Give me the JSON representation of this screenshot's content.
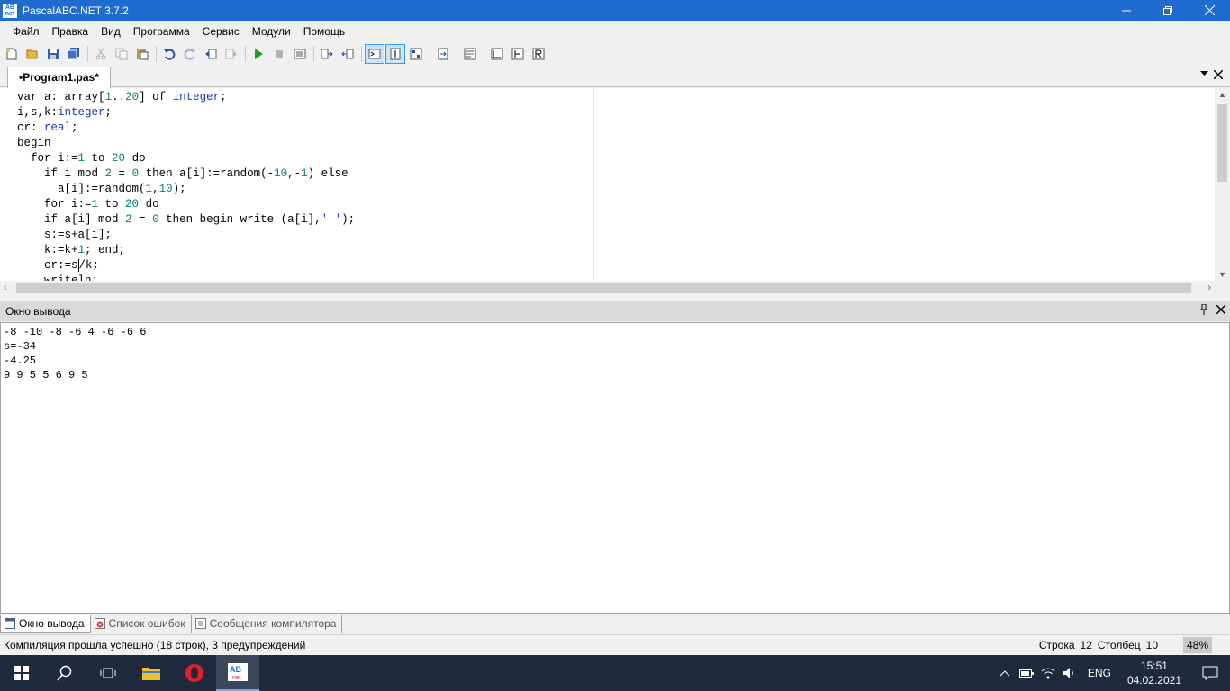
{
  "window": {
    "title": "PascalABC.NET 3.7.2",
    "app_icon_text": "AB\nnet"
  },
  "menu": [
    "Файл",
    "Правка",
    "Вид",
    "Программа",
    "Сервис",
    "Модули",
    "Помощь"
  ],
  "document_tab": {
    "label": "•Program1.pas*"
  },
  "editor": {
    "lines": [
      [
        [
          "kw",
          "var a: "
        ],
        [
          "kw",
          "array"
        ],
        [
          "kw",
          "["
        ],
        [
          "nm",
          "1"
        ],
        [
          "kw",
          ".."
        ],
        [
          "nm",
          "20"
        ],
        [
          "kw",
          "] "
        ],
        [
          "kw",
          "of "
        ],
        [
          "ty",
          "integer"
        ],
        [
          "kw",
          ";"
        ]
      ],
      [
        [
          "kw",
          "i,s,k:"
        ],
        [
          "ty",
          "integer"
        ],
        [
          "kw",
          ";"
        ]
      ],
      [
        [
          "kw",
          "cr: "
        ],
        [
          "ty",
          "real"
        ],
        [
          "kw",
          ";"
        ]
      ],
      [
        [
          "kw",
          "begin"
        ]
      ],
      [
        [
          "kw",
          "  for i:="
        ],
        [
          "nm",
          "1"
        ],
        [
          "kw",
          " to "
        ],
        [
          "nm",
          "20"
        ],
        [
          "kw",
          " do"
        ]
      ],
      [
        [
          "kw",
          "    if i mod "
        ],
        [
          "nm",
          "2"
        ],
        [
          "kw",
          " = "
        ],
        [
          "nm",
          "0"
        ],
        [
          "kw",
          " then a[i]:=random(-"
        ],
        [
          "nm",
          "10"
        ],
        [
          "kw",
          ",-"
        ],
        [
          "nm",
          "1"
        ],
        [
          "kw",
          ") else"
        ]
      ],
      [
        [
          "kw",
          "      a[i]:=random("
        ],
        [
          "nm",
          "1"
        ],
        [
          "kw",
          ","
        ],
        [
          "nm",
          "10"
        ],
        [
          "kw",
          ");"
        ]
      ],
      [
        [
          "kw",
          "    for i:="
        ],
        [
          "nm",
          "1"
        ],
        [
          "kw",
          " to "
        ],
        [
          "nm",
          "20"
        ],
        [
          "kw",
          " do"
        ]
      ],
      [
        [
          "kw",
          "    if a[i] mod "
        ],
        [
          "nm",
          "2"
        ],
        [
          "kw",
          " = "
        ],
        [
          "nm",
          "0"
        ],
        [
          "kw",
          " then begin write (a[i],"
        ],
        [
          "st",
          "' '"
        ],
        [
          "kw",
          ");"
        ]
      ],
      [
        [
          "kw",
          "    s:=s+a[i];"
        ]
      ],
      [
        [
          "kw",
          "    k:=k+"
        ],
        [
          "nm",
          "1"
        ],
        [
          "kw",
          "; end;"
        ]
      ],
      [
        [
          "kw",
          "    cr:=s"
        ],
        [
          "caret",
          ""
        ],
        [
          "kw",
          "/k;"
        ]
      ],
      [
        [
          "kw",
          "    writeln;"
        ]
      ]
    ]
  },
  "output": {
    "header": "Окно вывода",
    "lines": [
      "-8 -10 -8 -6 4 -6 -6 6",
      "s=-34",
      "-4.25",
      "9 9 5 5 6 9 5"
    ]
  },
  "bottom_tabs": [
    "Окно вывода",
    "Список ошибок",
    "Сообщения компилятора"
  ],
  "status": {
    "message": "Компиляция прошла успешно (18 строк), 3 предупреждений",
    "row_label": "Строка",
    "row_value": "12",
    "col_label": "Столбец",
    "col_value": "10",
    "zoom": "48%"
  },
  "tray": {
    "lang": "ENG",
    "time": "15:51",
    "date": "04.02.2021"
  },
  "colors": {
    "titlebar": "#1f6bd0",
    "taskbar": "#1f2a3c",
    "keyword_type": "#1a37c8",
    "number": "#008080"
  }
}
